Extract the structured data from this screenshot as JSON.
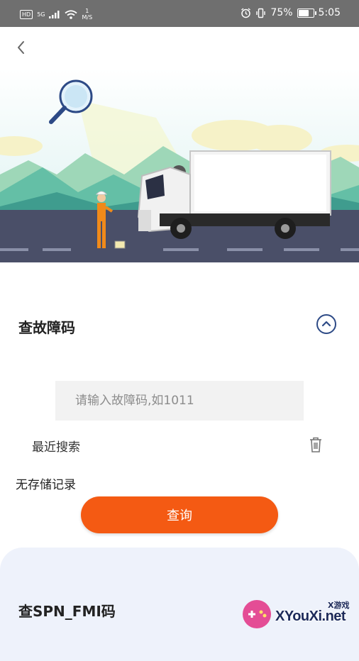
{
  "status_bar": {
    "hd": "HD",
    "network": "5G",
    "speed_value": "1",
    "speed_unit": "M/S",
    "battery_text": "75%",
    "battery_level": 0.75,
    "time": "5:05"
  },
  "header": {
    "back_icon": "chevron-left-icon"
  },
  "fault_code_card": {
    "title": "查故障码",
    "collapse_icon": "chevron-up-circle-icon",
    "input_placeholder": "请输入故障码,如1011",
    "input_value": "",
    "recent_label": "最近搜索",
    "trash_icon": "trash-icon",
    "empty_label": "无存储记录",
    "query_button": "查询",
    "accent_color": "#f45a13",
    "icon_color": "#2d4a86"
  },
  "spn_card": {
    "title": "查SPN_FMI码"
  },
  "watermark": {
    "text": "XYouXi.net",
    "small_text": "X游戏"
  }
}
